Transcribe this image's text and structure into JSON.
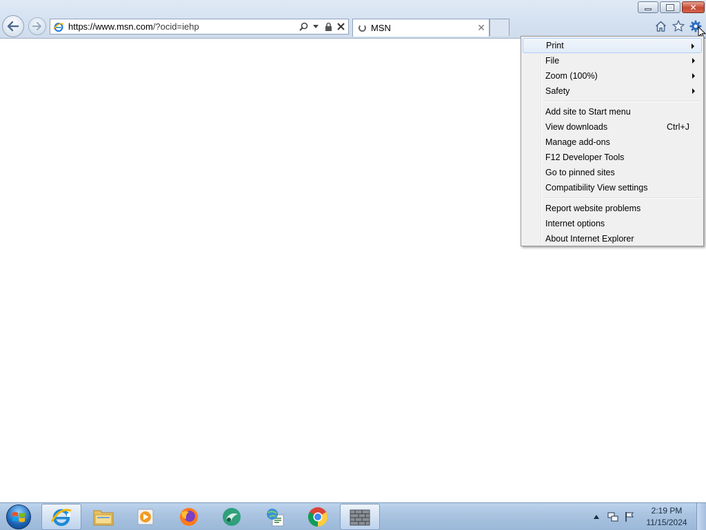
{
  "window": {
    "address": {
      "url_domain": "https://www.msn.com",
      "url_path": "/?ocid=iehp"
    },
    "tab": {
      "title": "MSN"
    }
  },
  "tools_menu": {
    "groups": [
      [
        {
          "label": "Print",
          "submenu": true
        },
        {
          "label": "File",
          "submenu": true
        },
        {
          "label": "Zoom (100%)",
          "submenu": true
        },
        {
          "label": "Safety",
          "submenu": true
        }
      ],
      [
        {
          "label": "Add site to Start menu",
          "shortcut": ""
        },
        {
          "label": "View downloads",
          "shortcut": "Ctrl+J"
        },
        {
          "label": "Manage add-ons",
          "shortcut": ""
        },
        {
          "label": "F12 Developer Tools",
          "shortcut": ""
        },
        {
          "label": "Go to pinned sites",
          "shortcut": ""
        },
        {
          "label": "Compatibility View settings",
          "shortcut": ""
        }
      ],
      [
        {
          "label": "Report website problems",
          "shortcut": ""
        },
        {
          "label": "Internet options",
          "shortcut": ""
        },
        {
          "label": "About Internet Explorer",
          "shortcut": ""
        }
      ]
    ],
    "highlighted_item": "Print"
  },
  "taskbar": {
    "apps": [
      {
        "name": "internet-explorer",
        "active": true
      },
      {
        "name": "file-explorer",
        "active": false
      },
      {
        "name": "media-player",
        "active": false
      },
      {
        "name": "firefox",
        "active": false
      },
      {
        "name": "green-circle-app",
        "active": false
      },
      {
        "name": "network-tool",
        "active": false
      },
      {
        "name": "chrome",
        "active": false
      },
      {
        "name": "firewall",
        "active": false
      }
    ],
    "clock": {
      "time": "2:19 PM",
      "date": "11/15/2024"
    }
  },
  "colors": {
    "menu_bg": "#f0f0f0",
    "menu_highlight": "#e2ecf9",
    "taskbar": "#a9c3e0",
    "chrome": "#d4e1f1"
  }
}
